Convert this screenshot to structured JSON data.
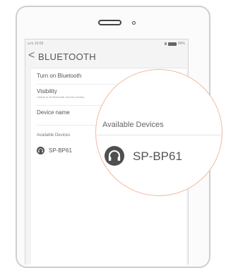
{
  "status_bar": {
    "time": "a.m.10:09",
    "battery": "84%"
  },
  "header": {
    "back_symbol": "<",
    "title": "BLUETOOTH"
  },
  "settings": {
    "turn_on_label": "Turn on Bluetooth",
    "bluetooth_on": true,
    "visibility_label": "Visibility",
    "visibility_sub": "Visible to all Bluetooth devices nearby",
    "device_name_label": "Device name",
    "available_label": "Available Devices"
  },
  "devices": [
    {
      "name": "SP-BP61",
      "icon": "headphones-icon"
    }
  ],
  "magnifier": {
    "header": "Available Devices",
    "device_name": "SP-BP61"
  },
  "colors": {
    "accent": "#f07f3c",
    "lens_border": "#f2b99c"
  }
}
